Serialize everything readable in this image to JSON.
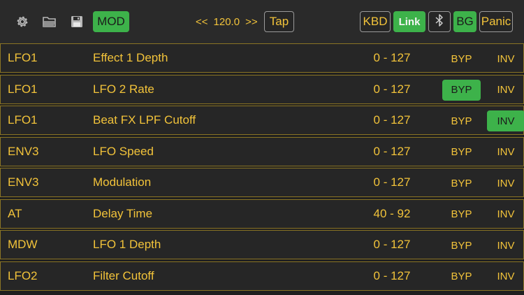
{
  "toolbar": {
    "icons": [
      "gear-icon",
      "folder-icon",
      "save-icon"
    ],
    "mod_label": "MOD",
    "tempo_down": "<<",
    "tempo_value": "120.0",
    "tempo_up": ">>",
    "tap_label": "Tap",
    "kbd_label": "KBD",
    "link_label": "Link",
    "bg_label": "BG",
    "panic_label": "Panic"
  },
  "rows": [
    {
      "source": "LFO1",
      "dest": "Effect 1 Depth",
      "range": "0 - 127",
      "byp": "BYP",
      "inv": "INV",
      "byp_on": false,
      "inv_on": false
    },
    {
      "source": "LFO1",
      "dest": "LFO 2 Rate",
      "range": "0 - 127",
      "byp": "BYP",
      "inv": "INV",
      "byp_on": true,
      "inv_on": false
    },
    {
      "source": "LFO1",
      "dest": "Beat FX LPF Cutoff",
      "range": "0 - 127",
      "byp": "BYP",
      "inv": "INV",
      "byp_on": false,
      "inv_on": true
    },
    {
      "source": "ENV3",
      "dest": "LFO Speed",
      "range": "0 - 127",
      "byp": "BYP",
      "inv": "INV",
      "byp_on": false,
      "inv_on": false
    },
    {
      "source": "ENV3",
      "dest": "Modulation",
      "range": "0 - 127",
      "byp": "BYP",
      "inv": "INV",
      "byp_on": false,
      "inv_on": false
    },
    {
      "source": "AT",
      "dest": "Delay Time",
      "range": "40 - 92",
      "byp": "BYP",
      "inv": "INV",
      "byp_on": false,
      "inv_on": false
    },
    {
      "source": "MDW",
      "dest": "LFO 1 Depth",
      "range": "0 - 127",
      "byp": "BYP",
      "inv": "INV",
      "byp_on": false,
      "inv_on": false
    },
    {
      "source": "LFO2",
      "dest": "Filter Cutoff",
      "range": "0 - 127",
      "byp": "BYP",
      "inv": "INV",
      "byp_on": false,
      "inv_on": false
    }
  ],
  "colors": {
    "accent_text": "#f2c33a",
    "active_green": "#3db24a",
    "row_border": "#8a7424",
    "background": "#1f1f1f"
  }
}
